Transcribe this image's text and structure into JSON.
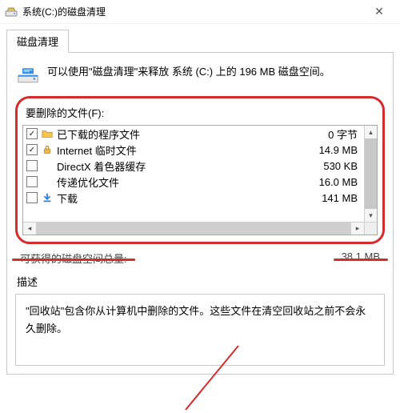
{
  "titlebar": {
    "title": "系统(C:)的磁盘清理"
  },
  "tab": {
    "label": "磁盘清理"
  },
  "intro": {
    "text": "可以使用\"磁盘清理\"来释放 系统 (C:) 上的 196 MB 磁盘空间。"
  },
  "group": {
    "label": "要删除的文件(F):"
  },
  "files": [
    {
      "checked": true,
      "icon": "folder",
      "name": "已下载的程序文件",
      "size": "0 字节"
    },
    {
      "checked": true,
      "icon": "lock",
      "name": "Internet 临时文件",
      "size": "14.9 MB"
    },
    {
      "checked": false,
      "icon": "blank",
      "name": "DirectX 着色器缓存",
      "size": "530 KB"
    },
    {
      "checked": false,
      "icon": "blank",
      "name": "传递优化文件",
      "size": "16.0 MB"
    },
    {
      "checked": false,
      "icon": "download",
      "name": "下载",
      "size": "141 MB"
    }
  ],
  "summary": {
    "label": "可获得的磁盘空间总量:",
    "value": "38.1 MB"
  },
  "description": {
    "heading": "描述",
    "body": "\"回收站\"包含你从计算机中删除的文件。这些文件在清空回收站之前不会永久删除。"
  }
}
